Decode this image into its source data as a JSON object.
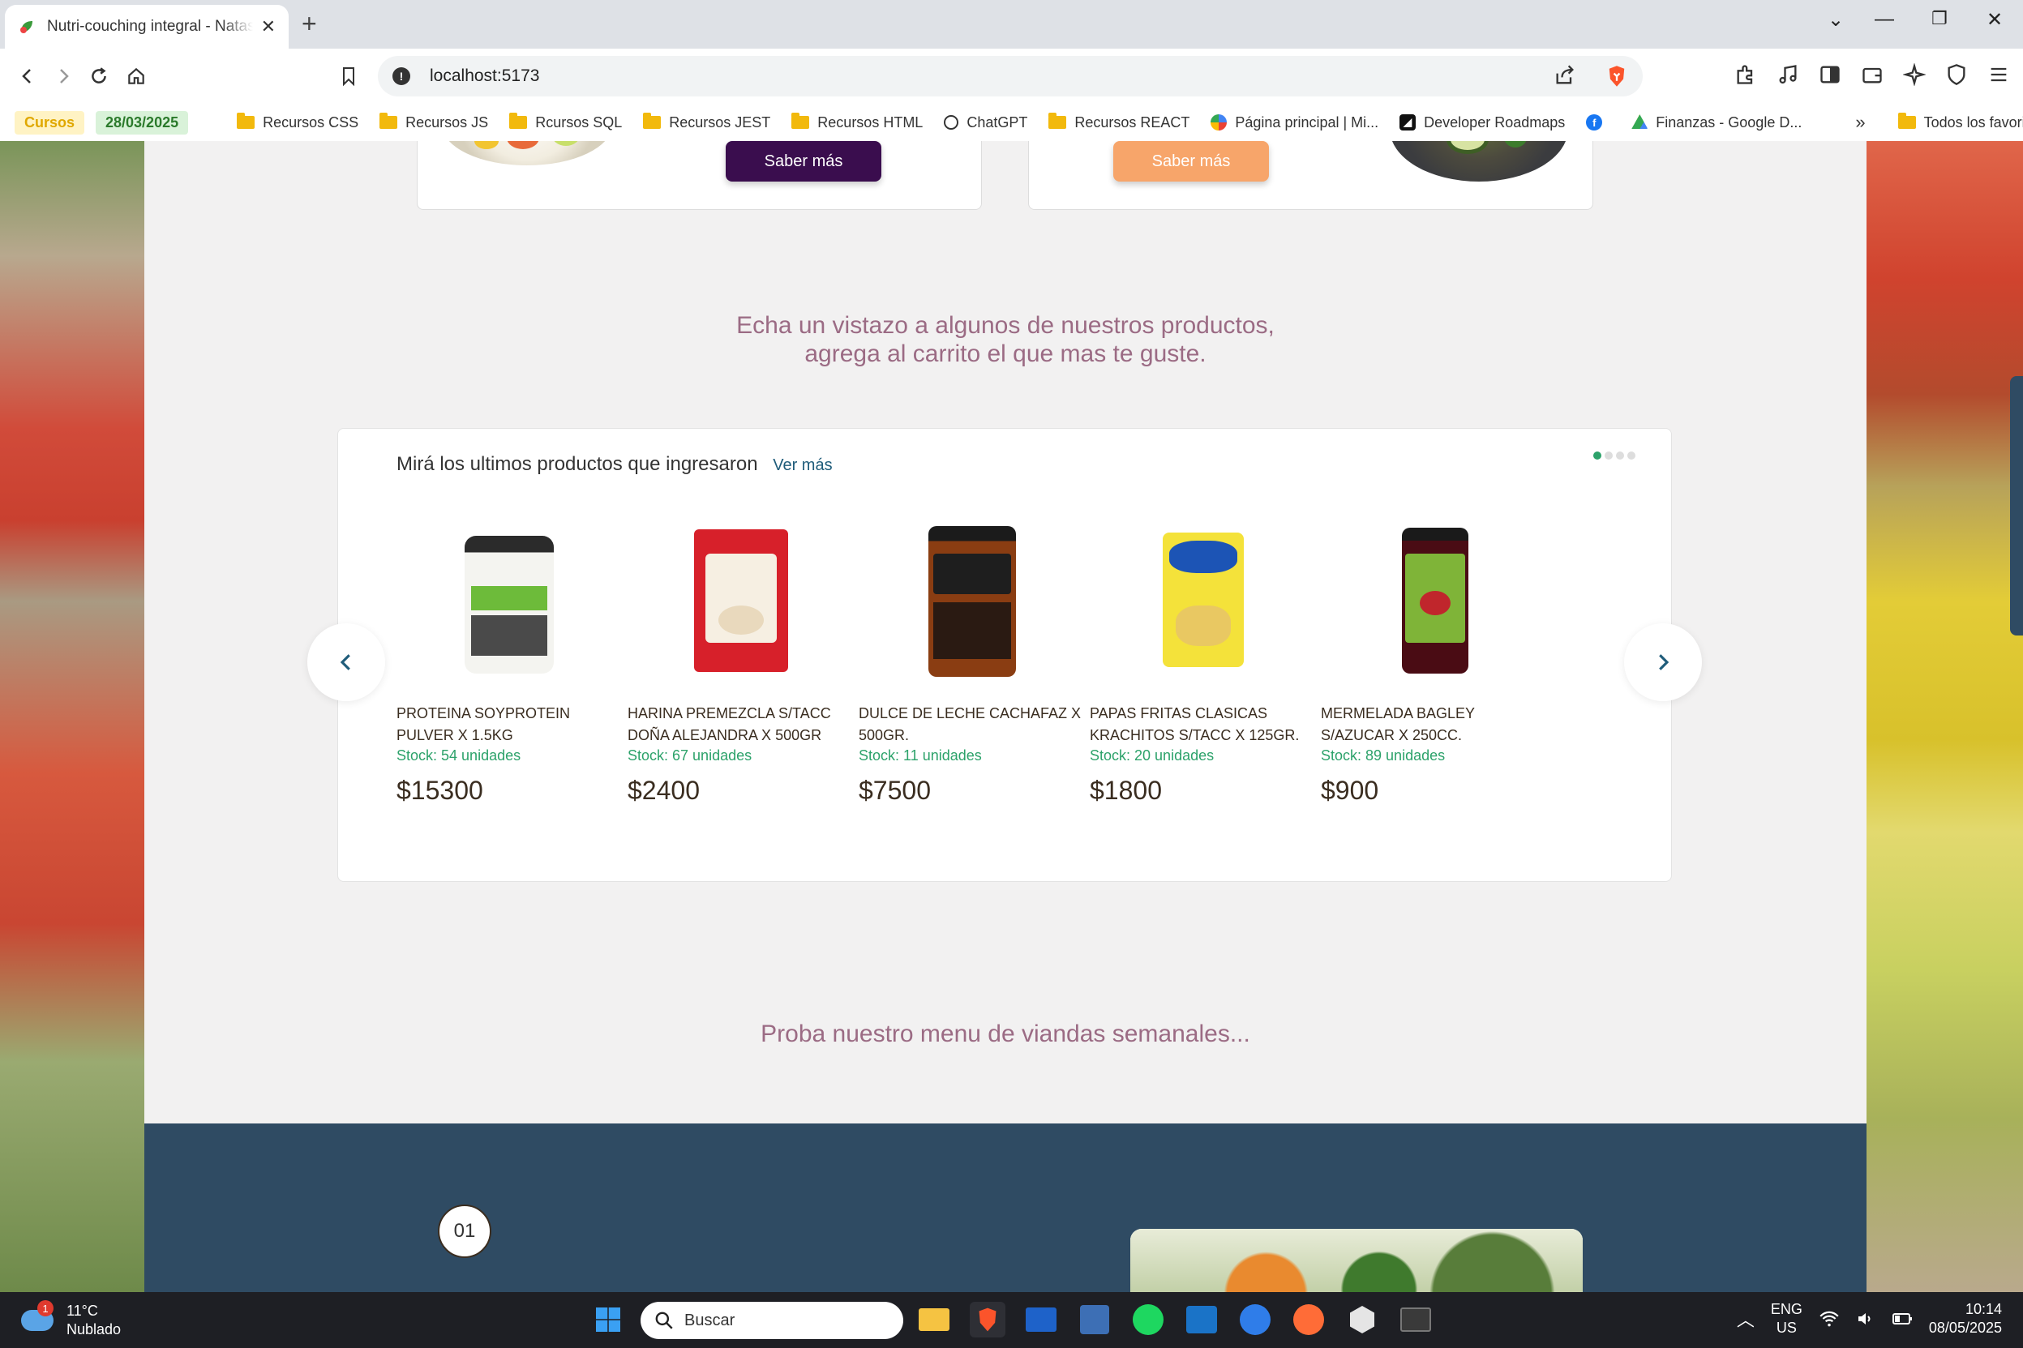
{
  "browser": {
    "tab_title": "Nutri-couching integral - Natas",
    "new_tab": "+",
    "url": "localhost:5173",
    "bookmarks": [
      {
        "label": "Cursos",
        "type": "chip",
        "bg": "#fff3c4",
        "color": "#e0a800"
      },
      {
        "label": "28/03/2025",
        "type": "chip",
        "bg": "#d9f2d9",
        "color": "#2b7a2b"
      },
      {
        "label": "Recursos CSS",
        "type": "folder"
      },
      {
        "label": "Recursos JS",
        "type": "folder"
      },
      {
        "label": "Rcursos SQL",
        "type": "folder"
      },
      {
        "label": "Recursos JEST",
        "type": "folder"
      },
      {
        "label": "Recursos HTML",
        "type": "folder"
      },
      {
        "label": "ChatGPT",
        "type": "site"
      },
      {
        "label": "Recursos REACT",
        "type": "folder"
      },
      {
        "label": "Página principal | Mi...",
        "type": "site"
      },
      {
        "label": "Developer Roadmaps",
        "type": "site"
      },
      {
        "label": "",
        "type": "site"
      },
      {
        "label": "Finanzas - Google D...",
        "type": "site"
      }
    ],
    "overflow": "»",
    "all_favorites": "Todos los favoritos"
  },
  "top_cards": {
    "left_button": "Saber más",
    "right_button": "Saber más"
  },
  "products_heading": {
    "line1": "Echa un vistazo a algunos de nuestros productos,",
    "line2": "agrega al carrito el que mas te guste."
  },
  "products_section": {
    "title": "Mirá los ultimos productos que ingresaron",
    "see_more": "Ver más",
    "items": [
      {
        "name": "PROTEINA SOYPROTEIN PULVER X 1.5KG",
        "stock": "Stock: 54 unidades",
        "price": "$15300"
      },
      {
        "name": "HARINA PREMEZCLA S/TACC DOÑA ALEJANDRA X 500GR",
        "stock": "Stock: 67 unidades",
        "price": "$2400"
      },
      {
        "name": "DULCE DE LECHE CACHAFAZ X 500GR.",
        "stock": "Stock: 11 unidades",
        "price": "$7500"
      },
      {
        "name": "PAPAS FRITAS CLASICAS KRACHITOS S/TACC X 125GR.",
        "stock": "Stock: 20 unidades",
        "price": "$1800"
      },
      {
        "name": "MERMELADA BAGLEY S/AZUCAR X 250CC.",
        "stock": "Stock: 89 unidades",
        "price": "$900"
      }
    ]
  },
  "menu_heading": "Proba nuestro menu de viandas semanales...",
  "step_number": "01",
  "taskbar": {
    "weather_badge": "1",
    "temperature": "11°C",
    "condition": "Nublado",
    "search_placeholder": "Buscar",
    "lang": "ENG",
    "region": "US",
    "time": "10:14",
    "date": "08/05/2025"
  }
}
